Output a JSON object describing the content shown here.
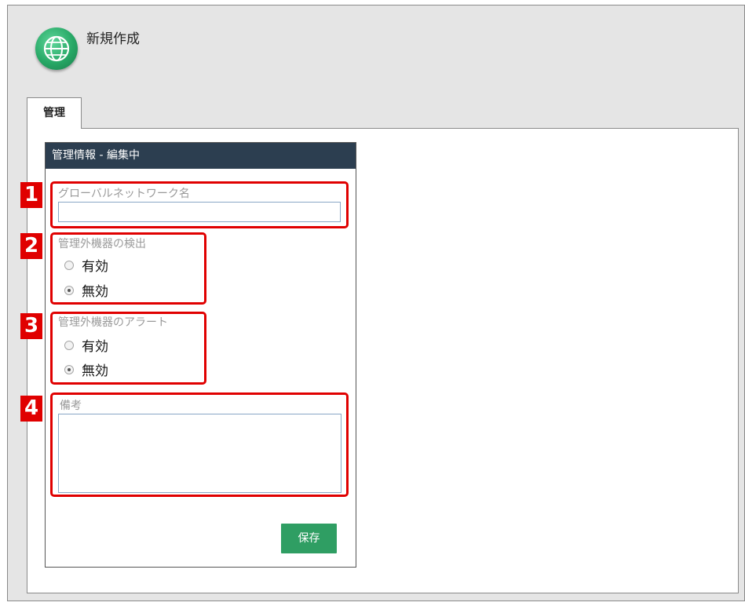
{
  "app": {
    "title": "新規作成",
    "icon": "globe-icon"
  },
  "tabs": [
    {
      "label": "管理",
      "active": true
    }
  ],
  "panel": {
    "header": "管理情報 - 編集中",
    "fields": {
      "network_name": {
        "label": "グローバルネットワーク名",
        "value": ""
      },
      "detect_unmanaged": {
        "label": "管理外機器の検出",
        "options": [
          "有効",
          "無効"
        ],
        "selected": "無効"
      },
      "alert_unmanaged": {
        "label": "管理外機器のアラート",
        "options": [
          "有効",
          "無効"
        ],
        "selected": "無効"
      },
      "notes": {
        "label": "備考",
        "value": ""
      }
    },
    "save_label": "保存"
  },
  "callouts": [
    "1",
    "2",
    "3",
    "4"
  ],
  "colors": {
    "header_bg": "#2c3e50",
    "save_bg": "#2f9e63",
    "callout": "#e00000",
    "globe": "#27a866"
  }
}
